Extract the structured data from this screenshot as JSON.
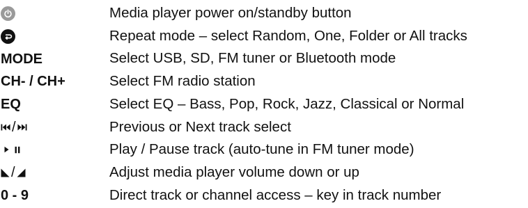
{
  "colors": {
    "power_button": "#9a9a9a",
    "repeat_button": "#111111",
    "text": "#111111"
  },
  "rows": [
    {
      "icon": "power-icon",
      "desc": "Media player power on/standby button"
    },
    {
      "icon": "repeat-icon",
      "desc": "Repeat mode – select Random, One, Folder or All tracks"
    },
    {
      "key": "MODE",
      "desc": "Select USB, SD, FM tuner or Bluetooth mode"
    },
    {
      "key": "CH- / CH+",
      "desc": "Select FM radio station"
    },
    {
      "key": "EQ",
      "desc": "Select EQ – Bass, Pop, Rock, Jazz, Classical or Normal"
    },
    {
      "icon": "previous-next-icon",
      "separator": "/",
      "desc": "Previous or Next track select"
    },
    {
      "icon": "play-pause-icon",
      "desc": "Play / Pause track (auto-tune in FM tuner mode)"
    },
    {
      "icon": "volume-down-up-icon",
      "separator": "/",
      "desc": "Adjust media player volume down or up"
    },
    {
      "key": "0 - 9",
      "desc": "Direct track or channel access – key in track number"
    }
  ]
}
